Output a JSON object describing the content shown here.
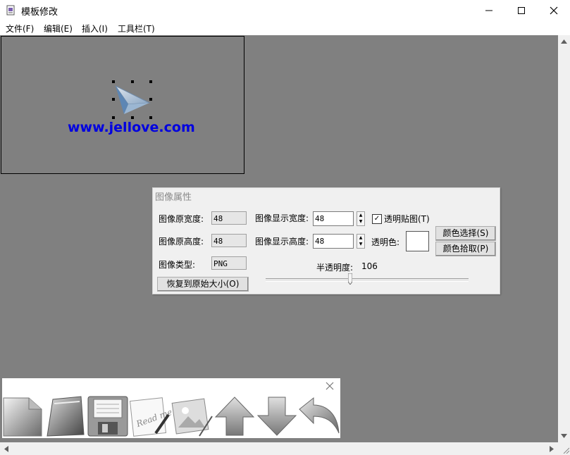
{
  "window": {
    "title": "模板修改"
  },
  "menu": [
    "文件(F)",
    "编辑(E)",
    "插入(I)",
    "工具栏(T)"
  ],
  "template": {
    "url_text": "www.jellove.com"
  },
  "panel": {
    "title": "图像属性",
    "orig_width_label": "图像原宽度:",
    "orig_width_value": "48",
    "orig_height_label": "图像原高度:",
    "orig_height_value": "48",
    "type_label": "图像类型:",
    "type_value": "PNG",
    "restore_button": "恢复到原始大小(O)",
    "disp_width_label": "图像显示宽度:",
    "disp_width_value": "48",
    "disp_height_label": "图像显示高度:",
    "disp_height_value": "48",
    "transparent_checkbox": "透明贴图(T)",
    "transparent_checked": true,
    "transparent_color_label": "透明色:",
    "transparent_color": "#ffffff",
    "color_select_button": "颜色选择(S)",
    "color_pick_button": "颜色拾取(P)",
    "opacity_label": "半透明度:",
    "opacity_value": "106",
    "opacity_max": 255
  },
  "toolbar": {
    "icons": [
      "new-document-icon",
      "open-folder-icon",
      "save-floppy-icon",
      "readme-edit-icon",
      "image-edit-icon",
      "arrow-up-icon",
      "arrow-down-icon",
      "undo-curved-icon"
    ]
  },
  "colors": {
    "workspace": "#808080",
    "url": "#0000e0"
  }
}
